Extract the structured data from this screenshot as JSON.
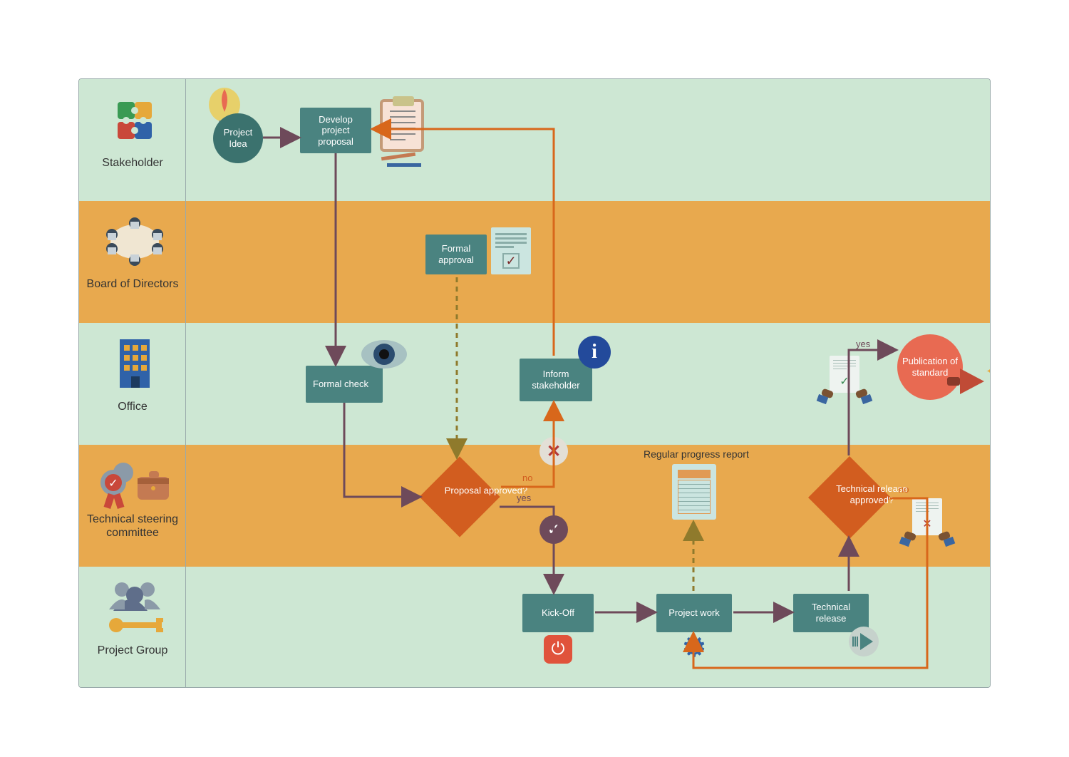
{
  "lanes": {
    "stakeholder": "Stakeholder",
    "board": "Board of Directors",
    "office": "Office",
    "tsc": "Technical steering committee",
    "project_group": "Project Group"
  },
  "nodes": {
    "project_idea": "Project Idea",
    "develop_proposal": "Develop project proposal",
    "formal_approval": "Formal approval",
    "formal_check": "Formal check",
    "inform_stakeholder": "Inform stakeholder",
    "proposal_approved": "Proposal approved?",
    "technical_release_approved": "Technical release approved?",
    "kick_off": "Kick-Off",
    "project_work": "Project work",
    "technical_release": "Technical release",
    "publication": "Publication of standard",
    "regular_report": "Regular progress report"
  },
  "edges": {
    "yes": "yes",
    "no": "no"
  },
  "colors": {
    "lane_green": "#cde7d3",
    "lane_orange": "#e8a94e",
    "node_teal": "#4a8380",
    "decision_orange": "#d25d1f",
    "end_red": "#e86a52",
    "flow_purple": "#6e4a5a",
    "flow_orange": "#d8671b",
    "flow_olive_dash": "#8f7a2c"
  }
}
